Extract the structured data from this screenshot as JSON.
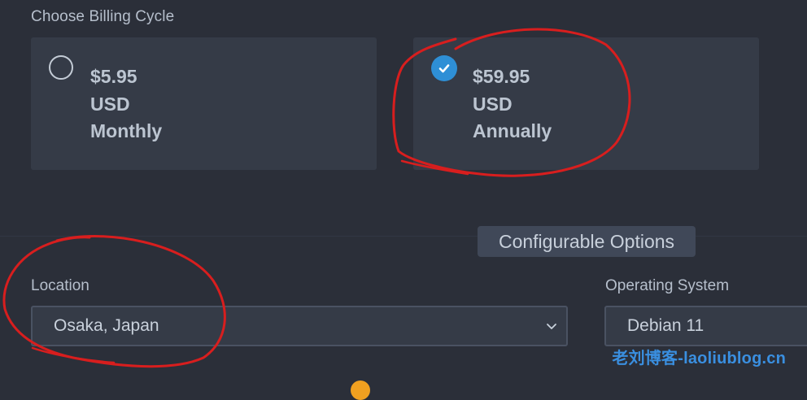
{
  "billing": {
    "title": "Choose Billing Cycle",
    "options": [
      {
        "price": "$5.95",
        "currency": "USD",
        "period": "Monthly",
        "selected": false
      },
      {
        "price": "$59.95",
        "currency": "USD",
        "period": "Annually",
        "selected": true
      }
    ]
  },
  "config": {
    "badge": "Configurable Options",
    "location": {
      "label": "Location",
      "value": "Osaka, Japan"
    },
    "os": {
      "label": "Operating System",
      "value": "Debian 11"
    }
  },
  "watermark": "老刘博客-laoliublog.cn",
  "colors": {
    "background": "#2b2f39",
    "card": "#353b47",
    "accent": "#2e8fd6",
    "annotation": "#d81e1e"
  }
}
